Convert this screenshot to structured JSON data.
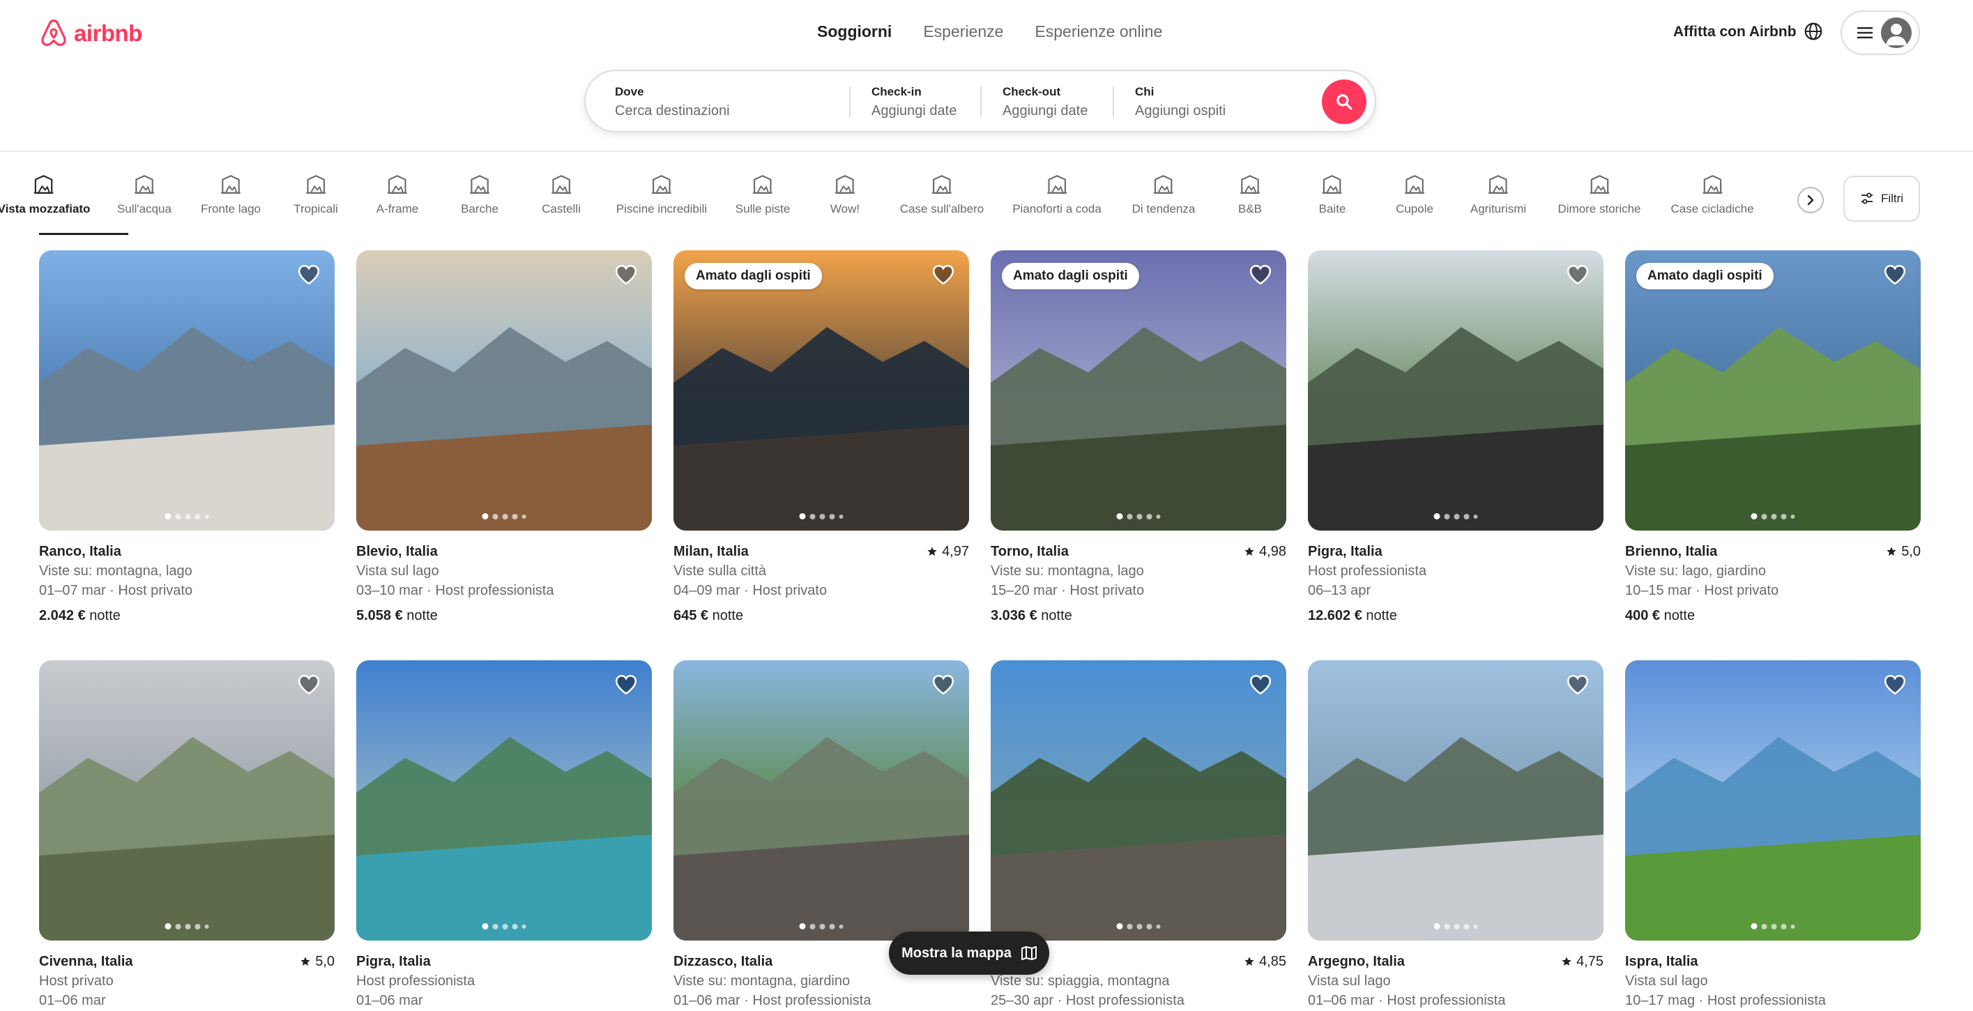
{
  "brand": {
    "name": "airbnb",
    "color": "#ff385c"
  },
  "nav": {
    "tabs": [
      "Soggiorni",
      "Esperienze",
      "Esperienze online"
    ],
    "active": "Soggiorni"
  },
  "header_right": {
    "host_label": "Affitta con Airbnb",
    "globe_icon": "globe-icon",
    "menu_icon": "hamburger-icon",
    "avatar_icon": "user-avatar-icon"
  },
  "search": {
    "where": {
      "label": "Dove",
      "placeholder": "Cerca destinazioni"
    },
    "checkin": {
      "label": "Check-in",
      "placeholder": "Aggiungi date"
    },
    "checkout": {
      "label": "Check-out",
      "placeholder": "Aggiungi date"
    },
    "who": {
      "label": "Chi",
      "placeholder": "Aggiungi ospiti"
    },
    "button_icon": "search-icon"
  },
  "categories": [
    "Vista mozzafiato",
    "Sull'acqua",
    "Fronte lago",
    "Tropicali",
    "A-frame",
    "Barche",
    "Castelli",
    "Piscine incredibili",
    "Sulle piste",
    "Wow!",
    "Case sull'albero",
    "Pianoforti a coda",
    "Di tendenza",
    "B&B",
    "Baite",
    "Cupole",
    "Agriturismi",
    "Dimore storiche",
    "Case cicladiche"
  ],
  "active_category": "Vista mozzafiato",
  "filters_label": "Filtri",
  "map_button_label": "Mostra la mappa",
  "price_unit": "notte",
  "listings": [
    {
      "location": "Ranco, Italia",
      "rating": "",
      "line1": "Viste su: montagna, lago",
      "line2": "01–07 mar · Host privato",
      "price": "2.042 €",
      "badge": ""
    },
    {
      "location": "Blevio, Italia",
      "rating": "",
      "line1": "Vista sul lago",
      "line2": "03–10 mar · Host professionista",
      "price": "5.058 €",
      "badge": ""
    },
    {
      "location": "Milan, Italia",
      "rating": "4,97",
      "line1": "Viste sulla città",
      "line2": "04–09 mar · Host privato",
      "price": "645 €",
      "badge": "Amato dagli ospiti"
    },
    {
      "location": "Torno, Italia",
      "rating": "4,98",
      "line1": "Viste su: montagna, lago",
      "line2": "15–20 mar · Host privato",
      "price": "3.036 €",
      "badge": "Amato dagli ospiti"
    },
    {
      "location": "Pigra, Italia",
      "rating": "",
      "line1": "Host professionista",
      "line2": "06–13 apr",
      "price": "12.602 €",
      "badge": ""
    },
    {
      "location": "Brienno, Italia",
      "rating": "5,0",
      "line1": "Viste su: lago, giardino",
      "line2": "10–15 mar · Host privato",
      "price": "400 €",
      "badge": "Amato dagli ospiti"
    },
    {
      "location": "Civenna, Italia",
      "rating": "5,0",
      "line1": "Host privato",
      "line2": "01–06 mar",
      "price": "",
      "badge": ""
    },
    {
      "location": "Pigra, Italia",
      "rating": "",
      "line1": "Host professionista",
      "line2": "01–06 mar",
      "price": "",
      "badge": ""
    },
    {
      "location": "Dizzasco, Italia",
      "rating": "",
      "line1": "Viste su: montagna, giardino",
      "line2": "01–06 mar · Host professionista",
      "price": "",
      "badge": ""
    },
    {
      "location": "Italia",
      "rating": "4,85",
      "line1": "Viste su: spiaggia, montagna",
      "line2": "25–30 apr · Host professionista",
      "price": "",
      "badge": ""
    },
    {
      "location": "Argegno, Italia",
      "rating": "4,75",
      "line1": "Vista sul lago",
      "line2": "01–06 mar · Host professionista",
      "price": "",
      "badge": ""
    },
    {
      "location": "Ispra, Italia",
      "rating": "",
      "line1": "Vista sul lago",
      "line2": "10–17 mag · Host professionista",
      "price": "",
      "badge": ""
    }
  ]
}
